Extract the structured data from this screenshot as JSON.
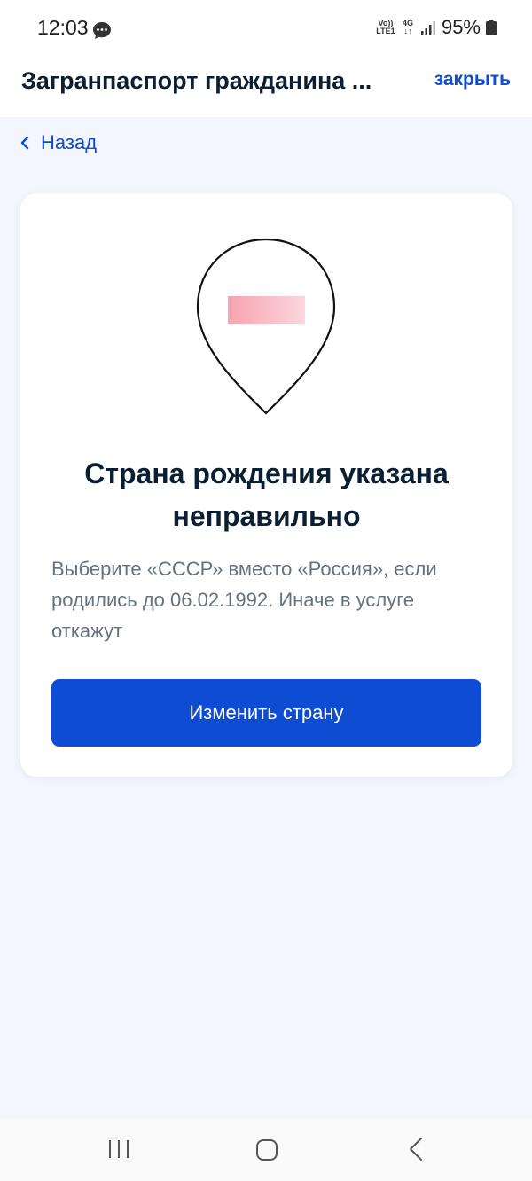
{
  "status_bar": {
    "time": "12:03",
    "network_top": "Vo)) 4G",
    "lte": "LTE1",
    "g4": "4G",
    "battery": "95%"
  },
  "header": {
    "title": "Загранпаспорт гражданина ...",
    "close_label": "закрыть"
  },
  "back": {
    "label": "Назад"
  },
  "card": {
    "title": "Страна рождения указана неправильно",
    "text": "Выберите «СССР» вместо «Россия», если родились до 06.02.1992. Иначе в услуге откажут",
    "button_label": "Изменить страну"
  },
  "colors": {
    "accent": "#0d4cd3",
    "background": "#f3f6fd",
    "title": "#0b1f33",
    "secondary_text": "#66727f",
    "pin_fill": "#f7b3bd"
  },
  "icons": {
    "chat": "chat-bubble-icon",
    "signal": "signal-icon",
    "battery": "battery-icon",
    "back": "chevron-left-icon",
    "pin": "location-pin-icon",
    "nav_recent": "recent-apps-icon",
    "nav_home": "home-icon",
    "nav_back": "back-icon"
  }
}
